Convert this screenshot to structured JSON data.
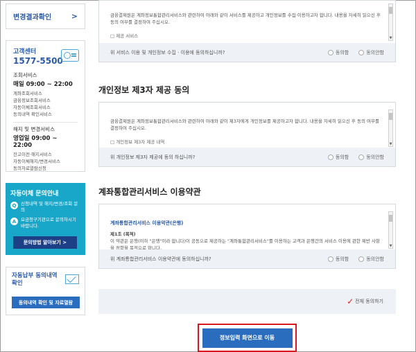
{
  "sidebar": {
    "result_check": {
      "label": "변경결과확인",
      "chevron": ">"
    },
    "customer_center": {
      "title": "고객센터",
      "phone": "1577-5500",
      "icon": "customer-card-icon",
      "inquiry_service": "조회서비스",
      "inquiry_hours": "매일 09:00 ~ 22:00",
      "inquiry_items": [
        "계좌조회서비스",
        "금융정보조회서비스",
        "자동이체조회서비스",
        "동의내역 확인서비스"
      ],
      "change_service": "해지 및 변경서비스",
      "change_hours": "영업일 09:00 ~ 22:00",
      "change_items": [
        "잔고이전·해지서비스",
        "자동이체해지/변경서비스",
        "동의자료열람신청"
      ]
    },
    "auto_transfer": {
      "title": "자동이체 문의안내",
      "rows": [
        {
          "badge": "Q",
          "text": "신청내역 및 해지/변경/조회 문의"
        },
        {
          "badge": "A",
          "text": "요금청구기관으로 문의하시기 바랍니다."
        }
      ],
      "button": "문의방법 알아보기 >"
    },
    "auto_pay_consent": {
      "title": "자동납부 동의내역 확인",
      "icon": "envelope-check-icon",
      "button": "동의내역 확인 및 자료열람"
    }
  },
  "main": {
    "terms": [
      {
        "body": "금융결제원은 계좌정보통합관리서비스와 관련하여 아래와 같이 서비스를 제공하고 개인정보를 수집·이용하고자 합니다. 내용을 자세히 읽으신 후 동의 여부를 결정하여 주십시오.",
        "item": "□ 제공 서비스",
        "question": "위 서비스 이용 및 개인정보 수집 · 이용에 동의하십니까?",
        "agree": "동의함",
        "disagree": "동의안함"
      },
      {
        "title": "개인정보 제3자 제공 동의",
        "body": "금융결제원은 계좌정보통합관리서비스와 관련하여 아래와 같이 제3자에게 개인정보를 제공하고자 합니다. 내용을 자세히 읽으신 후 동의 여부를 결정하여 주십시오.",
        "item": "□ 개인정보 제3자 제공 내역",
        "question": "위 개인정보 제3자 제공에 동의 하십니까?",
        "agree": "동의함",
        "disagree": "동의안함"
      },
      {
        "title": "계좌통합관리서비스 이용약관",
        "inner_title": "계좌통합관리서비스 이용약관(은행)",
        "article": "제1조 (목적)",
        "body": "이 약관은 은행(이하 \"은행\"이라 합니다)이 공동으로 제공하는 \"계좌통합관리서비스\"를 이용하는 고객과 은행간의 서비스 이용에 관한 제반 사항을 정함을 목적으로 합니다.",
        "question": "위 계좌통합관리서비스 이용약관에 동의하십니까?",
        "agree": "동의함",
        "disagree": "동의안함"
      }
    ],
    "all_agree": "전체 동의하기",
    "proceed_button": "정보입력 화면으로 이동",
    "accent_color": "#2a6dbf",
    "highlight_color": "#d9171e"
  }
}
